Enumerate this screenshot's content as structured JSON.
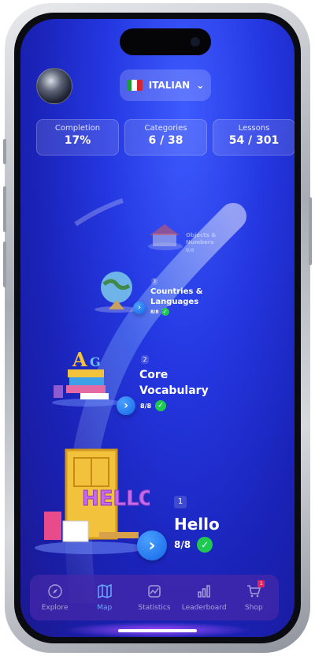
{
  "language": {
    "label": "ITALIAN",
    "flag_colors": [
      "#1e9a3e",
      "#ffffff",
      "#d8262e"
    ]
  },
  "stats": [
    {
      "label": "Completion",
      "value": "17%"
    },
    {
      "label": "Categories",
      "value": "6 / 38"
    },
    {
      "label": "Lessons",
      "value": "54 / 301"
    }
  ],
  "nodes": [
    {
      "number": "1",
      "title": "Hello",
      "progress": "8/8"
    },
    {
      "number": "2",
      "title": "Core Vocabulary",
      "title_line1": "Core",
      "title_line2": "Vocabulary",
      "progress": "8/8"
    },
    {
      "number": "3",
      "title": "Countries & Languages",
      "title_line1": "Countries &",
      "title_line2": "Languages",
      "progress": "8/8"
    },
    {
      "number": "",
      "title": "Objects & Numbers",
      "title_line1": "Objects &",
      "title_line2": "Numbers",
      "progress": "0/8"
    }
  ],
  "tabs": [
    {
      "label": "Explore",
      "icon": "compass-icon",
      "active": false
    },
    {
      "label": "Map",
      "icon": "map-icon",
      "active": true
    },
    {
      "label": "Statistics",
      "icon": "statistics-icon",
      "active": false
    },
    {
      "label": "Leaderboard",
      "icon": "leaderboard-icon",
      "active": false
    },
    {
      "label": "Shop",
      "icon": "cart-icon",
      "active": false,
      "badge": "1"
    }
  ],
  "colors": {
    "accent": "#6aa8ff",
    "success": "#1fc850",
    "background": "#2437e0"
  }
}
